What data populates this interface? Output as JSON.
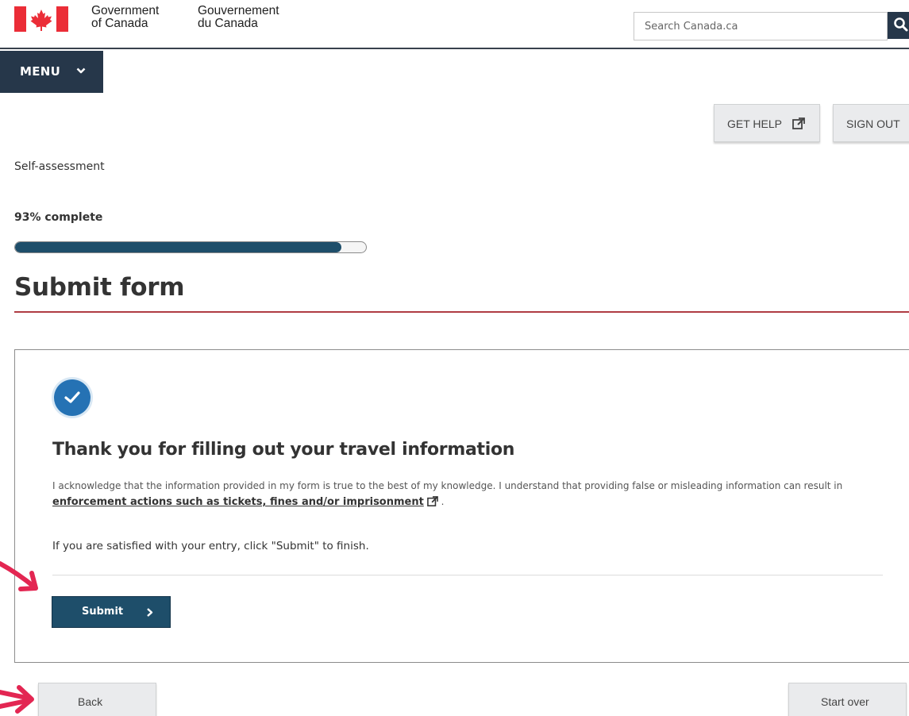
{
  "header": {
    "gov_en_line1": "Government",
    "gov_en_line2": "of Canada",
    "gov_fr_line1": "Gouvernement",
    "gov_fr_line2": "du Canada",
    "search_placeholder": "Search Canada.ca",
    "search_icon": "magnifier-icon"
  },
  "menu": {
    "label": "MENU",
    "icon": "chevron-down-icon"
  },
  "actions": {
    "get_help_label": "GET HELP",
    "get_help_icon": "external-link-icon",
    "sign_out_label": "SIGN OUT"
  },
  "progress": {
    "section": "Self-assessment",
    "text": "93% complete",
    "percent": 93
  },
  "page": {
    "title": "Submit form"
  },
  "card": {
    "status_icon": "checkmark-icon",
    "heading": "Thank you for filling out your travel information",
    "ack_text_before": "I acknowledge that the information provided in my form is true to the best of my knowledge. I understand that providing false or misleading information can result in ",
    "ack_link": "enforcement actions such as tickets, fines and/or imprisonment",
    "ack_text_after": ".",
    "instruction": "If you are satisfied with your entry, click \"Submit\" to finish.",
    "submit_label": "Submit",
    "submit_icon": "chevron-right-icon"
  },
  "footer_nav": {
    "back_label": "Back",
    "start_over_label": "Start over"
  },
  "colors": {
    "navy": "#26374a",
    "progress_fill": "#1e4e6a",
    "title_rule": "#af3c43",
    "check_blue": "#2572b4",
    "flag_red": "#eb2d37",
    "annotation_pink": "#e32652"
  }
}
